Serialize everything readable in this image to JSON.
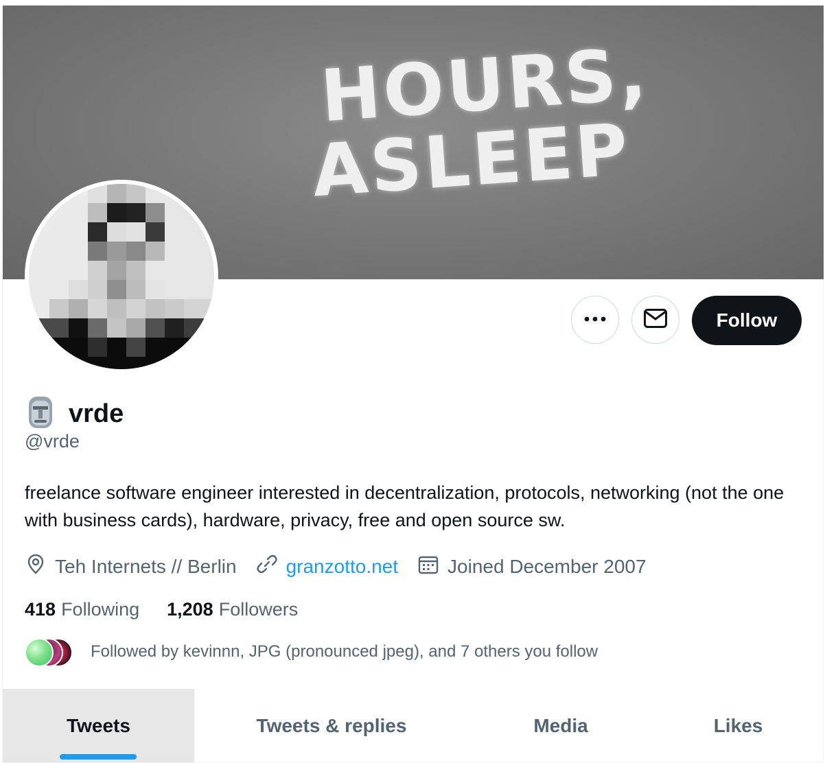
{
  "banner": {
    "text_line1": "HOURS,",
    "text_line2": "ASLEEP"
  },
  "profile": {
    "emoji": "🗿",
    "display_name": "vrde",
    "handle": "@vrde",
    "bio": "freelance software engineer interested in decentralization, protocols, networking (not the one with business cards), hardware, privacy, free and open source sw.",
    "location": "Teh Internets // Berlin",
    "website": "granzotto.net",
    "joined": "Joined December 2007"
  },
  "actions": {
    "more_icon": "more-horizontal-icon",
    "message_icon": "envelope-icon",
    "follow_label": "Follow"
  },
  "counts": {
    "following_num": "418",
    "following_label": "Following",
    "followers_num": "1,208",
    "followers_label": "Followers"
  },
  "followed_by": "Followed by kevinnn, JPG (pronounced jpeg), and 7 others you follow",
  "tabs": [
    {
      "label": "Tweets",
      "active": true
    },
    {
      "label": "Tweets & replies",
      "active": false
    },
    {
      "label": "Media",
      "active": false
    },
    {
      "label": "Likes",
      "active": false
    }
  ],
  "colors": {
    "accent": "#1d9bf0",
    "text": "#0f1419",
    "secondary": "#536471",
    "follow_bg": "#0f1419"
  }
}
